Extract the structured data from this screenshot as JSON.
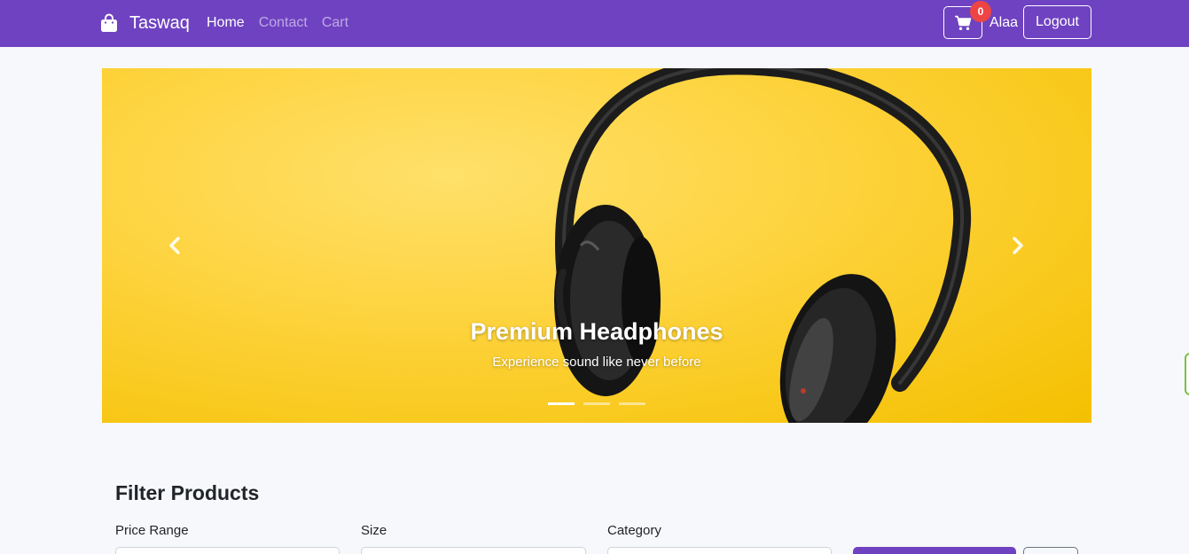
{
  "navbar": {
    "brand": "Taswaq",
    "links": [
      {
        "label": "Home",
        "active": true
      },
      {
        "label": "Contact",
        "active": false
      },
      {
        "label": "Cart",
        "active": false
      }
    ],
    "cart_count": "0",
    "username": "Alaa",
    "logout_label": "Logout",
    "icons": {
      "brand": "shopping-bag-icon",
      "cart": "cart-icon"
    }
  },
  "carousel": {
    "title": "Premium Headphones",
    "subtitle": "Experience sound like never before",
    "slide_count": 3,
    "active_slide": 1,
    "icons": {
      "prev": "chevron-left-icon",
      "next": "chevron-right-icon"
    }
  },
  "filter": {
    "title": "Filter Products",
    "price_label": "Price Range",
    "size_label": "Size",
    "category_label": "Category"
  },
  "colors": {
    "primary": "#6f42c1",
    "badge": "#ef4444",
    "hero_yellow": "#fdd23a",
    "background": "#f7f8fb"
  }
}
